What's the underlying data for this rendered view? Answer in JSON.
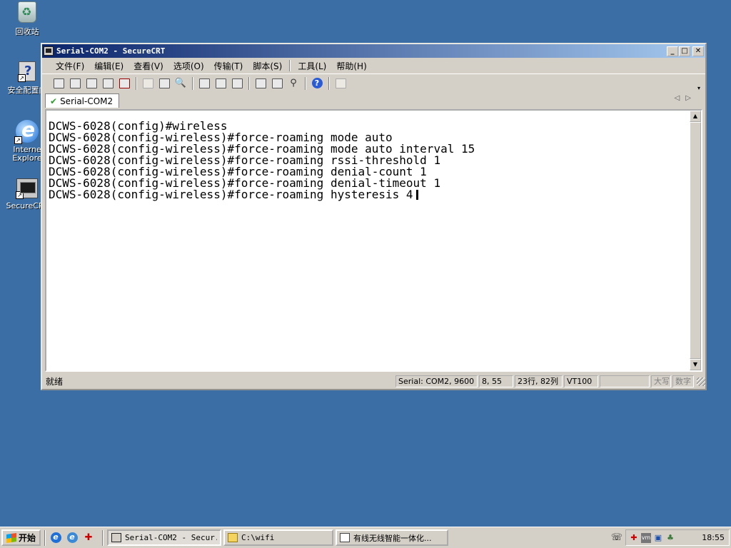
{
  "desktop": {
    "icons": [
      {
        "label": "回收站"
      },
      {
        "label": "安全配置向"
      },
      {
        "label": "Interne\nExplore"
      },
      {
        "label": "SecureCRT"
      }
    ]
  },
  "window": {
    "title": "Serial-COM2 - SecureCRT",
    "menu": [
      "文件(F)",
      "编辑(E)",
      "查看(V)",
      "选项(O)",
      "传输(T)",
      "脚本(S)",
      "工具(L)",
      "帮助(H)"
    ],
    "tab_label": "Serial-COM2",
    "terminal_lines": [
      "DCWS-6028(config)#wireless",
      "DCWS-6028(config-wireless)#force-roaming mode auto",
      "DCWS-6028(config-wireless)#force-roaming mode auto interval 15",
      "DCWS-6028(config-wireless)#force-roaming rssi-threshold 1",
      "DCWS-6028(config-wireless)#force-roaming denial-count 1",
      "DCWS-6028(config-wireless)#force-roaming denial-timeout 1",
      "DCWS-6028(config-wireless)#force-roaming hysteresis 4"
    ],
    "status": {
      "ready": "就绪",
      "connection": "Serial: COM2, 9600",
      "cursor_pos": "8, 55",
      "size": "23行, 82列",
      "emulation": "VT100",
      "blank": "",
      "caps": "大写",
      "num": "数字"
    }
  },
  "taskbar": {
    "start": "开始",
    "tasks": [
      "Serial-COM2 - Secur...",
      "C:\\wifi",
      "有线无线智能一体化..."
    ],
    "clock": "18:55"
  }
}
